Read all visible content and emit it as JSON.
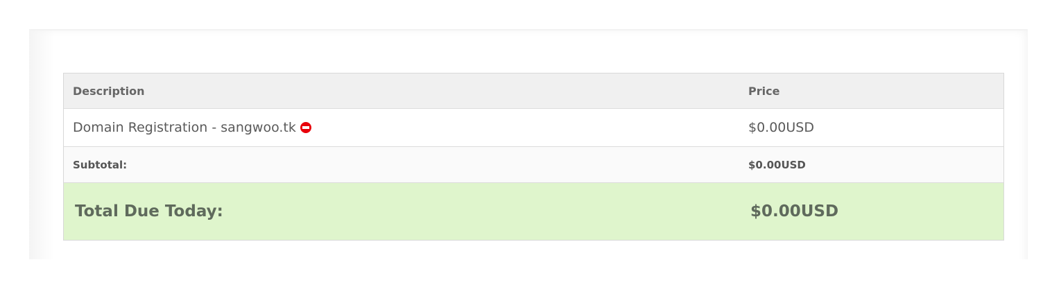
{
  "cart": {
    "header": {
      "description": "Description",
      "price": "Price"
    },
    "items": [
      {
        "description": "Domain Registration - sangwoo.tk",
        "price": "$0.00USD",
        "remove_icon": "remove-circle-icon"
      }
    ],
    "subtotal": {
      "label": "Subtotal:",
      "value": "$0.00USD"
    },
    "total": {
      "label": "Total Due Today:",
      "value": "$0.00USD"
    }
  },
  "colors": {
    "header_bg": "#f0f0f0",
    "total_bg": "#dff5cc",
    "remove_icon": "#e8000b"
  }
}
